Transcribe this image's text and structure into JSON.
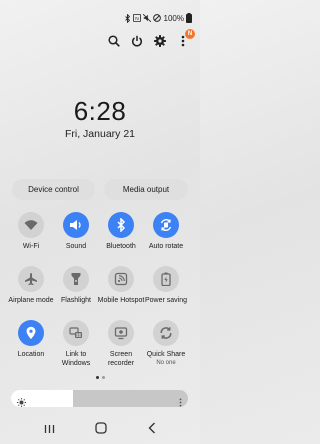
{
  "status_bar": {
    "battery_percent": "100%",
    "icons": [
      "bluetooth-icon",
      "nfc-icon",
      "mute-icon",
      "no-disturb-icon",
      "battery-icon"
    ]
  },
  "top_actions": {
    "icons": [
      "search-icon",
      "power-icon",
      "gear-icon",
      "more-icon"
    ],
    "notification_badge": "N",
    "badge_color": "#f0782a"
  },
  "lock": {
    "time": "6:28",
    "date": "Fri, January 21"
  },
  "pills": {
    "device_control": "Device control",
    "media_output": "Media output"
  },
  "tiles": [
    {
      "label": "Wi-Fi",
      "sub": "",
      "on": false,
      "icon": "wifi-icon"
    },
    {
      "label": "Sound",
      "sub": "",
      "on": true,
      "icon": "sound-icon"
    },
    {
      "label": "Bluetooth",
      "sub": "",
      "on": true,
      "icon": "bluetooth-icon"
    },
    {
      "label": "Auto rotate",
      "sub": "",
      "on": true,
      "icon": "auto-rotate-icon"
    },
    {
      "label": "Airplane mode",
      "sub": "",
      "on": false,
      "icon": "airplane-icon"
    },
    {
      "label": "Flashlight",
      "sub": "",
      "on": false,
      "icon": "flashlight-icon"
    },
    {
      "label": "Mobile Hotspot",
      "sub": "",
      "on": false,
      "icon": "hotspot-icon"
    },
    {
      "label": "Power saving",
      "sub": "",
      "on": false,
      "icon": "power-saving-icon"
    },
    {
      "label": "Location",
      "sub": "",
      "on": true,
      "icon": "location-icon"
    },
    {
      "label": "Link to Windows",
      "sub": "",
      "on": false,
      "icon": "link-to-windows-icon"
    },
    {
      "label": "Screen recorder",
      "sub": "",
      "on": false,
      "icon": "screen-recorder-icon"
    },
    {
      "label": "Quick Share",
      "sub": "No one",
      "on": false,
      "icon": "quick-share-icon"
    }
  ],
  "accent_color": "#3d82f4",
  "pager": {
    "pages": 2,
    "active": 1
  },
  "brightness": {
    "level": 0.35
  },
  "navbar": {
    "icons": [
      "recents-icon",
      "home-icon",
      "back-icon"
    ]
  }
}
